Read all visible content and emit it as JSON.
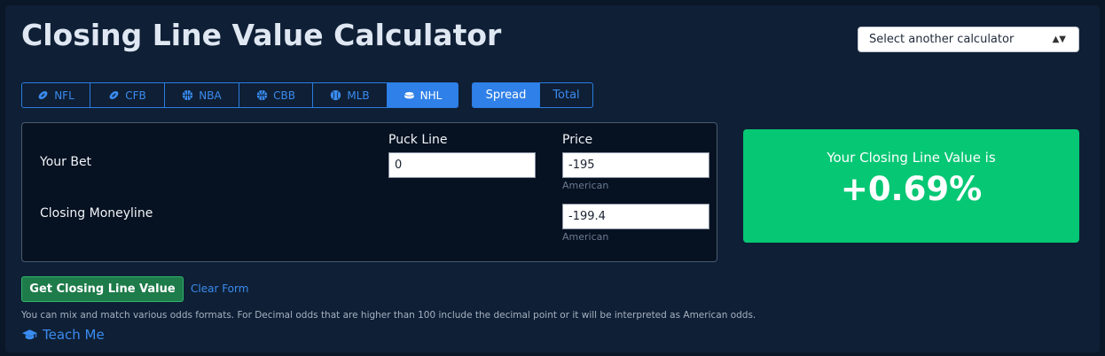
{
  "header": {
    "title": "Closing Line Value Calculator",
    "calculator_select": {
      "selected": "Select another calculator",
      "caret_icon": "up-down-caret-icon"
    }
  },
  "sport_tabs": [
    {
      "label": "NFL",
      "icon": "football-icon",
      "active": false
    },
    {
      "label": "CFB",
      "icon": "football-icon",
      "active": false
    },
    {
      "label": "NBA",
      "icon": "basketball-icon",
      "active": false
    },
    {
      "label": "CBB",
      "icon": "basketball-icon",
      "active": false
    },
    {
      "label": "MLB",
      "icon": "baseball-icon",
      "active": false
    },
    {
      "label": "NHL",
      "icon": "hockey-puck-icon",
      "active": true
    }
  ],
  "type_tabs": [
    {
      "label": "Spread",
      "active": true
    },
    {
      "label": "Total",
      "active": false
    }
  ],
  "form": {
    "line_header": "Puck Line",
    "price_header": "Price",
    "your_bet_label": "Your Bet",
    "your_bet_line": "0",
    "your_bet_price": "-195",
    "price_hint": "American",
    "closing_label": "Closing Moneyline",
    "closing_price": "-199.4",
    "closing_hint": "American"
  },
  "result": {
    "caption": "Your Closing Line Value is",
    "value": "+0.69%"
  },
  "actions": {
    "submit_label": "Get Closing Line Value",
    "clear_label": "Clear Form"
  },
  "footer": {
    "note": "You can mix and match various odds formats. For Decimal odds that are higher than 100 include the decimal point or it will be interpreted as American odds.",
    "teach_label": "Teach Me"
  },
  "colors": {
    "background": "#0a1728",
    "accent": "#2f80e8",
    "result_green": "#06c774",
    "submit_green": "#1e7b4a"
  }
}
